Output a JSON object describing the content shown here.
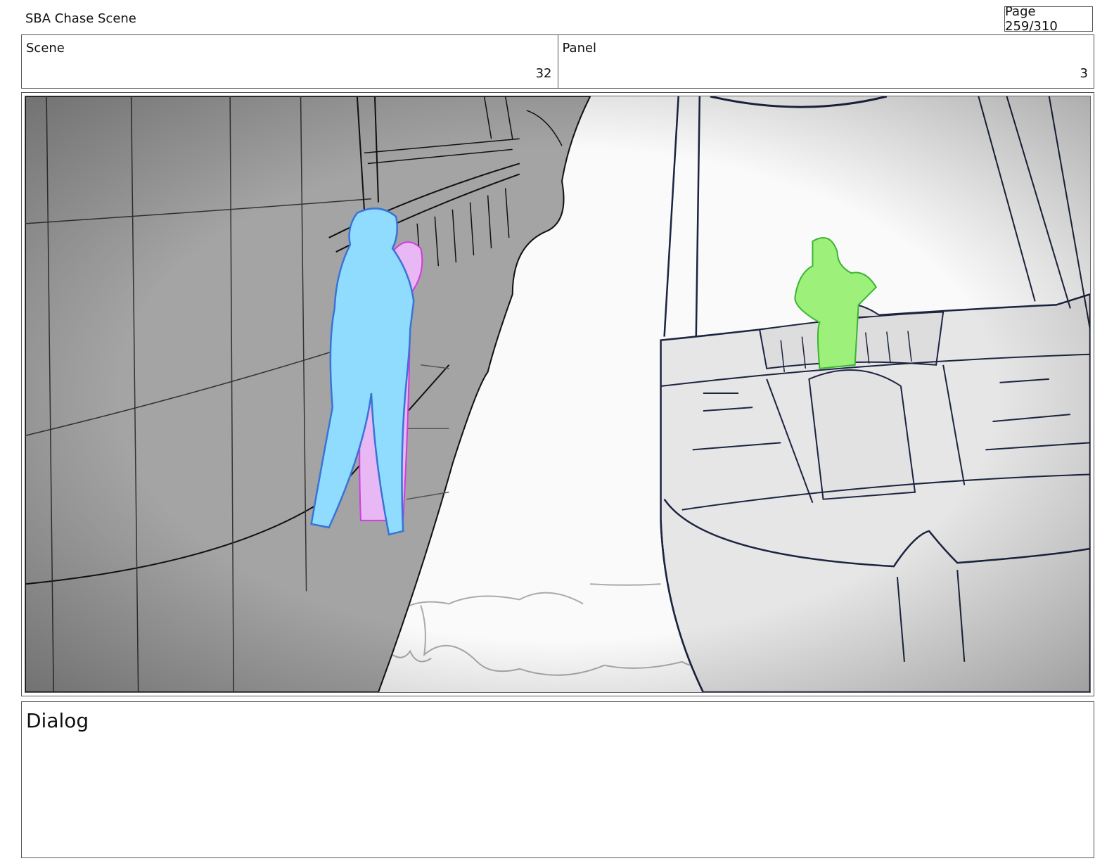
{
  "header": {
    "title": "SBA Chase Scene",
    "page": "Page 259/310"
  },
  "info": {
    "scene_label": "Scene",
    "scene_value": "32",
    "panel_label": "Panel",
    "panel_value": "3"
  },
  "dialog": {
    "label": "Dialog"
  },
  "colors": {
    "character_blue": "#8fdcff",
    "character_pink": "#e8b8f4",
    "character_green": "#9df07a",
    "left_ship": "#a4a4a4",
    "right_ship": "#e6e6e6",
    "ink": "#1c2440"
  }
}
